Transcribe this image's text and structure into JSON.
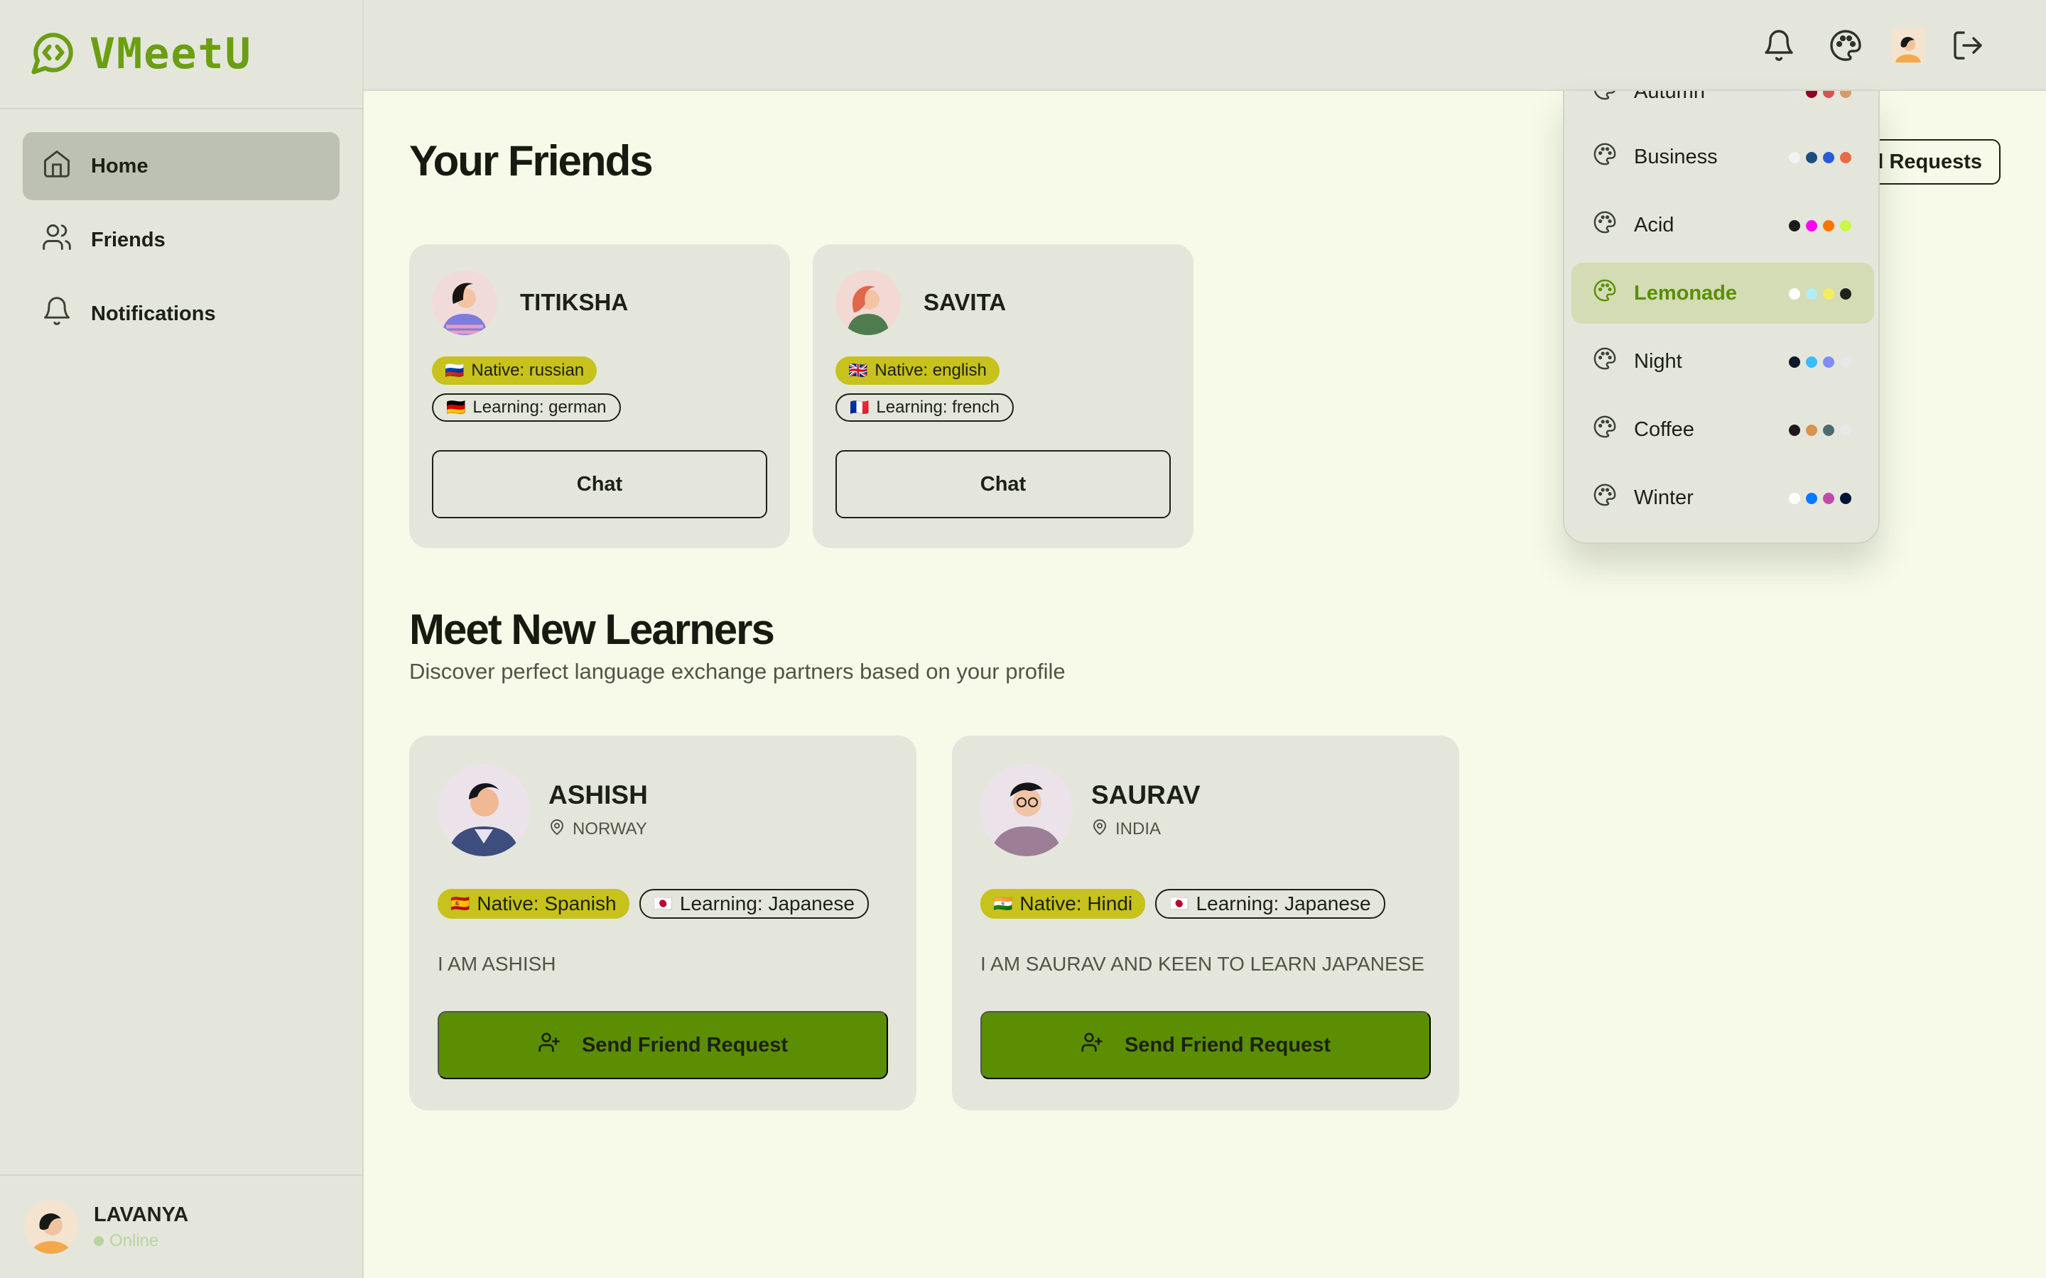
{
  "app": {
    "name": "VMeetU"
  },
  "sidebar": {
    "items": [
      {
        "label": "Home",
        "icon": "home-icon",
        "active": true
      },
      {
        "label": "Friends",
        "icon": "users-icon",
        "active": false
      },
      {
        "label": "Notifications",
        "icon": "bell-icon",
        "active": false
      }
    ],
    "user": {
      "name": "LAVANYA",
      "status": "Online"
    }
  },
  "header": {
    "icons": [
      "bell-icon",
      "palette-icon",
      "avatar",
      "logout-icon"
    ]
  },
  "friends_section": {
    "title": "Your Friends",
    "requests_button": "Friend Requests",
    "friends": [
      {
        "name": "TITIKSHA",
        "native": "Native: russian",
        "native_flag": "🇷🇺",
        "learning": "Learning: german",
        "learning_flag": "🇩🇪",
        "chat_label": "Chat"
      },
      {
        "name": "SAVITA",
        "native": "Native: english",
        "native_flag": "🇬🇧",
        "learning": "Learning: french",
        "learning_flag": "🇫🇷",
        "chat_label": "Chat"
      }
    ]
  },
  "learners_section": {
    "title": "Meet New Learners",
    "subtitle": "Discover perfect language exchange partners based on your profile",
    "learners": [
      {
        "name": "ASHISH",
        "location": "NORWAY",
        "native": "Native: Spanish",
        "native_flag": "🇪🇸",
        "learning": "Learning: Japanese",
        "learning_flag": "🇯🇵",
        "bio": "I AM ASHISH",
        "button": "Send Friend Request"
      },
      {
        "name": "SAURAV",
        "location": "INDIA",
        "native": "Native: Hindi",
        "native_flag": "🇮🇳",
        "learning": "Learning: Japanese",
        "learning_flag": "🇯🇵",
        "bio": "I AM SAURAV AND KEEN TO LEARN JAPANESE",
        "button": "Send Friend Request"
      }
    ]
  },
  "theme_menu": {
    "items": [
      {
        "label": "Autumn",
        "colors": [
          "#e5e5e5",
          "#8c0327",
          "#d85251",
          "#d59b6a"
        ]
      },
      {
        "label": "Business",
        "colors": [
          "#f2f2f2",
          "#1c4e80",
          "#2a5bd7",
          "#ea6947"
        ]
      },
      {
        "label": "Acid",
        "colors": [
          "#1b1b1b",
          "#ff00f4",
          "#ff7400",
          "#c8f945"
        ]
      },
      {
        "label": "Lemonade",
        "colors": [
          "#ffffff",
          "#aeeef4",
          "#f3ec5d",
          "#1f2418"
        ],
        "active": true
      },
      {
        "label": "Night",
        "colors": [
          "#0f172a",
          "#38bdf8",
          "#818cf8",
          "#e5e7eb"
        ]
      },
      {
        "label": "Coffee",
        "colors": [
          "#20161f",
          "#db924b",
          "#4f6a6f",
          "#e8e8e8"
        ]
      },
      {
        "label": "Winter",
        "colors": [
          "#ffffff",
          "#047aff",
          "#c149ad",
          "#021431"
        ]
      }
    ]
  }
}
